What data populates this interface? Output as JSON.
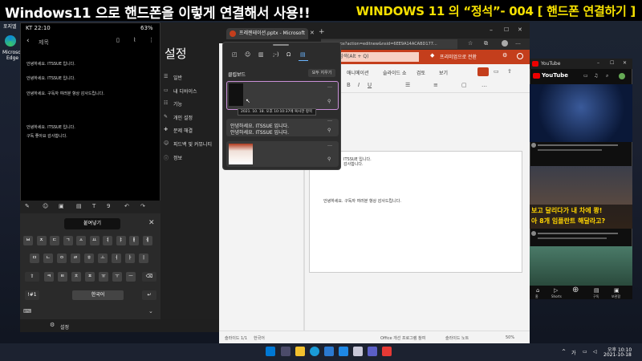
{
  "banner": {
    "left_title": "Windows11 으로 핸드폰을 이렇게 연결해서 사용!!",
    "right_title": "WINDOWS 11 의 “정석”- 004 [ 핸드폰 연결하기 ]"
  },
  "desktop": {
    "icon_top_label": "포지엘",
    "edge_label_1": "Microsoft",
    "edge_label_2": "Edge"
  },
  "phone": {
    "status_left": "KT 22:10",
    "status_right": "63%",
    "note_title": "제목",
    "lines": [
      "안녕하세요. ITSSUE 입니다.",
      "안녕하세요. ITSSUE 입니다.",
      "안녕하세요. 구독자 여러분 항상 감사드립니다.",
      "안녕하세요. ITSSUE 입니다.",
      "구독 좋아요 감사합니다."
    ],
    "paste_label": "붙여넣기",
    "keyboard": {
      "row1": [
        "ㅂ",
        "ㅈ",
        "ㄷ",
        "ㄱ",
        "ㅅ",
        "ㅛ",
        "ㅕ",
        "ㅑ",
        "ㅐ",
        "ㅔ"
      ],
      "row2": [
        "ㅁ",
        "ㄴ",
        "ㅇ",
        "ㄹ",
        "ㅎ",
        "ㅗ",
        "ㅓ",
        "ㅏ",
        "ㅣ"
      ],
      "row3": [
        "ㅋ",
        "ㅌ",
        "ㅊ",
        "ㅍ",
        "ㅠ",
        "ㅜ",
        "ㅡ"
      ],
      "sym_key": "!#1",
      "lang_key": "한국어",
      "toolbar_num": "9"
    },
    "settings_label": "설정"
  },
  "settings_app": {
    "title": "설정",
    "items": [
      "일반",
      "내 디바이스",
      "기능",
      "개인 설정",
      "문제 해결",
      "피드백 및 커뮤니티",
      "정보"
    ]
  },
  "ppt": {
    "tab_title": "프레젠테이션.pptx - Microsoft P",
    "address": "aspx?action=editnew&nsid=6EE9A14ACABD177...",
    "search_placeholder": "검색(Alt + Q)",
    "premium_label": "프리미엄으로 전환",
    "menu": [
      "애니메이션",
      "슬라이드 쇼",
      "검토",
      "보기"
    ],
    "slide_lines": [
      "ITSSUE 입니다.",
      "감사합니다.",
      "안녕하세요. 구독자 여러분 항상 감사드립니다."
    ],
    "status_left": "슬라이드 1/1",
    "status_lang": "한국어",
    "status_feedback": "Office 개선 프로그램 참여",
    "status_notes": "슬라이드 노트",
    "status_zoom": "50%"
  },
  "clipboard": {
    "title": "클립보드",
    "clear_label": "모두 지우기",
    "tooltip": "2021. 10. 18. 오후 10:10:37에 복사한 항목",
    "text_item_1": "안녕하세요. ITSSUE 입니다.",
    "text_item_2": "안녕하세요. ITSSUE 입니다."
  },
  "youtube": {
    "window_title": "YouTube",
    "logo": "YouTube",
    "thumb2_overlay_1": "보고 달리다가 내 차에 쾅!",
    "thumb2_overlay_2": "아 8개 임플란트 해달라고?",
    "nav": [
      "홈",
      "Shorts",
      "",
      "구독",
      "보관함"
    ]
  },
  "taskbar": {
    "time": "오후 10:10",
    "date": "2021-10-18",
    "lang": "가"
  },
  "colors": {
    "banner_yellow": "#f5e000",
    "ppt_red": "#c43e1c",
    "windows_blue": "#0078d4"
  }
}
